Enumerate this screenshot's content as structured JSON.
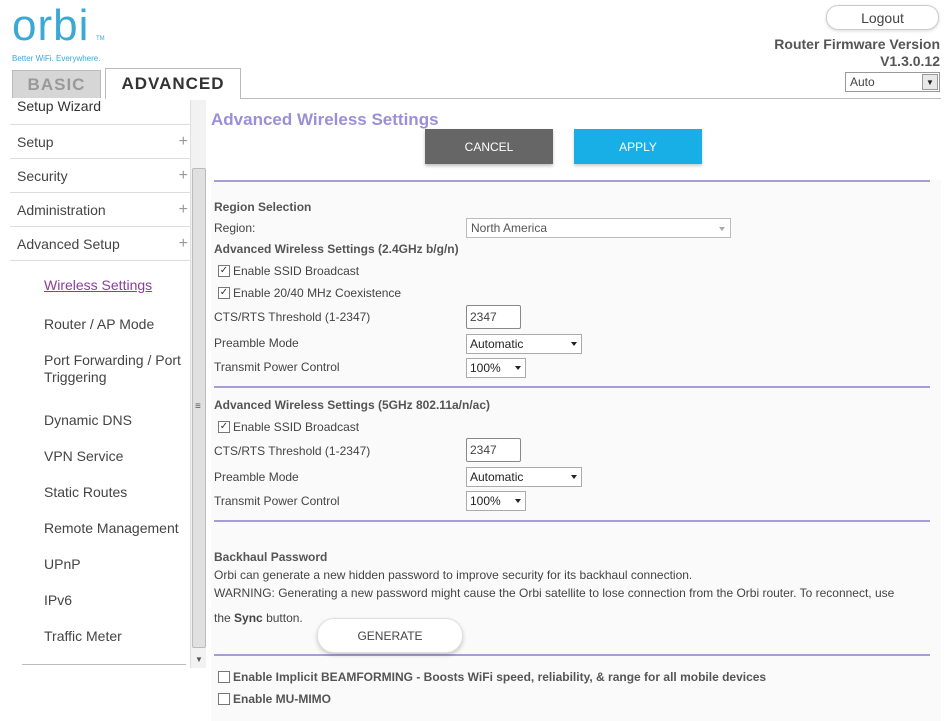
{
  "header": {
    "logo_text": "orbi",
    "logo_tm": "TM",
    "tagline": "Better WiFi. Everywhere.",
    "logout_label": "Logout",
    "firmware_label": "Router Firmware Version",
    "firmware_version": "V1.3.0.12",
    "language_value": "Auto"
  },
  "tabs": {
    "basic": "BASIC",
    "advanced": "ADVANCED"
  },
  "sidebar": {
    "cut_item": "Setup Wizard",
    "items": [
      {
        "label": "Setup"
      },
      {
        "label": "Security"
      },
      {
        "label": "Administration"
      },
      {
        "label": "Advanced Setup"
      }
    ],
    "sub_items": [
      {
        "label": "Wireless Settings"
      },
      {
        "label": "Router / AP Mode"
      },
      {
        "label": "Port Forwarding / Port Triggering"
      },
      {
        "label": "Dynamic DNS"
      },
      {
        "label": "VPN Service"
      },
      {
        "label": "Static Routes"
      },
      {
        "label": "Remote Management"
      },
      {
        "label": "UPnP"
      },
      {
        "label": "IPv6"
      },
      {
        "label": "Traffic Meter"
      }
    ]
  },
  "main": {
    "title": "Advanced Wireless Settings",
    "cancel_label": "CANCEL",
    "apply_label": "APPLY",
    "region": {
      "section_title": "Region Selection",
      "label": "Region:",
      "value": "North America"
    },
    "band24": {
      "section_title": "Advanced Wireless Settings (2.4GHz b/g/n)",
      "ssid_broadcast": "Enable SSID Broadcast",
      "coexistence": "Enable 20/40 MHz Coexistence",
      "cts_label": "CTS/RTS Threshold (1-2347)",
      "cts_value": "2347",
      "preamble_label": "Preamble Mode",
      "preamble_value": "Automatic",
      "power_label": "Transmit Power Control",
      "power_value": "100%"
    },
    "band5": {
      "section_title": "Advanced Wireless Settings (5GHz 802.11a/n/ac)",
      "ssid_broadcast": "Enable SSID Broadcast",
      "cts_label": "CTS/RTS Threshold (1-2347)",
      "cts_value": "2347",
      "preamble_label": "Preamble Mode",
      "preamble_value": "Automatic",
      "power_label": "Transmit Power Control",
      "power_value": "100%"
    },
    "backhaul": {
      "section_title": "Backhaul Password",
      "desc": "Orbi can generate a new hidden password to improve security for its backhaul connection.",
      "warning": "WARNING: Generating a new password might cause the Orbi satellite to lose connection from the Orbi router. To reconnect, use",
      "the_prefix": "the",
      "sync_word": "Sync",
      "button_suffix": "button.",
      "generate_label": "GENERATE"
    },
    "beamforming_label": "Enable Implicit BEAMFORMING - Boosts WiFi speed, reliability, & range for all mobile devices",
    "mumimo_label": "Enable MU-MIMO",
    "check_mark": "✓"
  },
  "colors": {
    "logo": "#3aa9d6",
    "title": "#9b8fd8",
    "apply": "#18aee6",
    "cancel": "#666666",
    "rule": "#a59ed6",
    "active_link": "#8a3d9c"
  }
}
